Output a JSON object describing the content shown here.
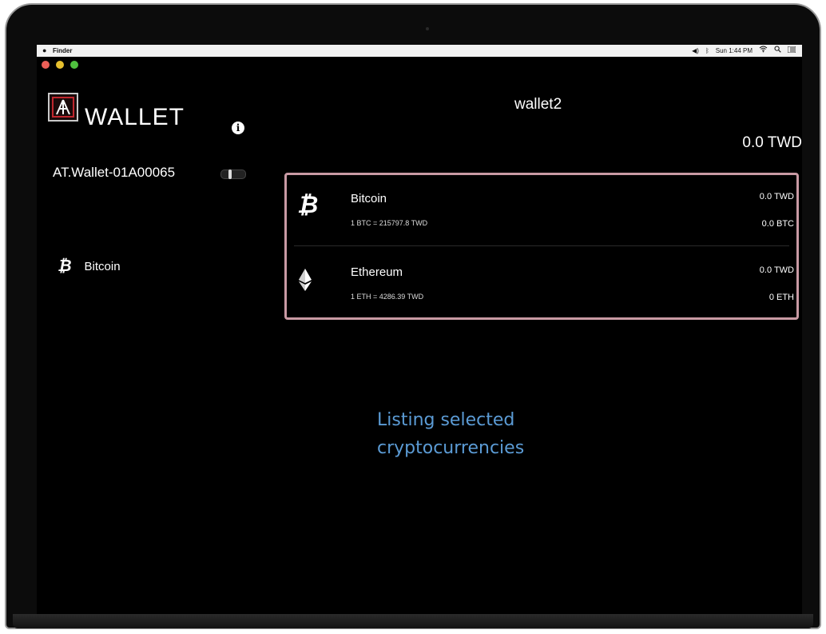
{
  "menubar": {
    "app_name": "Finder",
    "status": {
      "volume": "◀)",
      "bluetooth": "ᛒ",
      "clock": "Sun 1:44 PM",
      "wifi": "wifi-icon",
      "search": "search-icon",
      "menu": "list-icon"
    }
  },
  "sidebar": {
    "logo_text": "WALLET",
    "wallet_id": "AT.Wallet-01A00065",
    "coins": [
      {
        "symbol": "₿",
        "label": "Bitcoin"
      }
    ]
  },
  "main": {
    "wallet_name": "wallet2",
    "total": "0.0 TWD",
    "assets": [
      {
        "name": "Bitcoin",
        "icon": "bitcoin-icon",
        "symbol": "₿",
        "rate": "1 BTC = 215797.8 TWD",
        "fiat": "0.0 TWD",
        "crypto": "0.0 BTC"
      },
      {
        "name": "Ethereum",
        "icon": "ethereum-icon",
        "rate": "1 ETH = 4286.39 TWD",
        "fiat": "0.0 TWD",
        "crypto": "0 ETH"
      }
    ]
  },
  "caption": {
    "line1": "Listing selected",
    "line2": "cryptocurrencies"
  },
  "colors": {
    "highlight_border": "#c99aa4",
    "caption": "#5b9bd5",
    "logo_red": "#c0262d"
  }
}
